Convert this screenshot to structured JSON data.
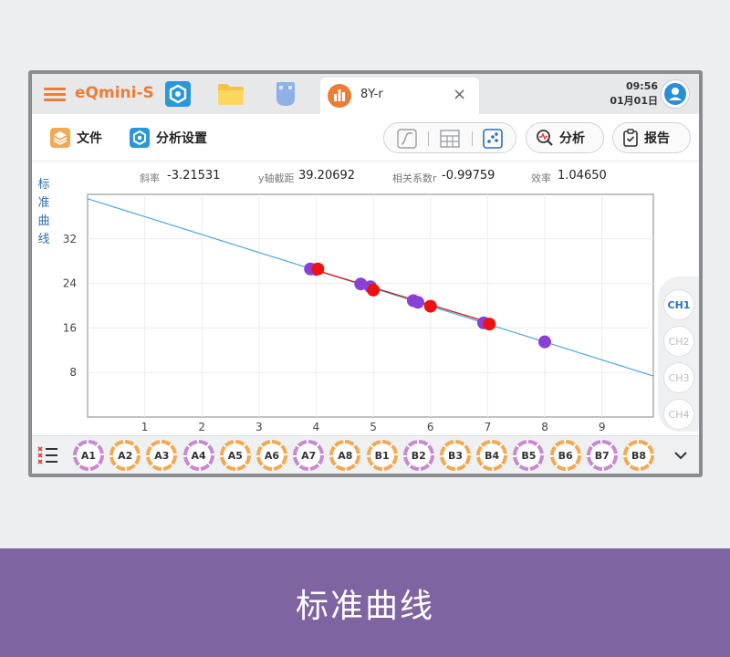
{
  "app": {
    "brand": "eQmini-S",
    "doc_tab_name": "8Y-r",
    "doc_tab_close": "×",
    "time": "09:56",
    "date": "01月01日"
  },
  "toolbar": {
    "file_label": "文件",
    "analysis_settings_label": "分析设置",
    "analyze_label": "分析",
    "report_label": "报告"
  },
  "stats": {
    "slope_label": "斜率",
    "slope_value": "-3.21531",
    "intercept_label": "y轴截距",
    "intercept_value": "39.20692",
    "correlation_label": "相关系数r",
    "correlation_value": "-0.99759",
    "efficiency_label": "效率",
    "efficiency_value": "1.04650"
  },
  "side_title": [
    "标",
    "准",
    "曲",
    "线"
  ],
  "channels": [
    {
      "label": "CH1",
      "active": true
    },
    {
      "label": "CH2",
      "active": false
    },
    {
      "label": "CH3",
      "active": false
    },
    {
      "label": "CH4",
      "active": false
    }
  ],
  "wells": [
    {
      "label": "A1",
      "color": "#c889d1"
    },
    {
      "label": "A2",
      "color": "#f3a953"
    },
    {
      "label": "A3",
      "color": "#f3a953"
    },
    {
      "label": "A4",
      "color": "#c889d1"
    },
    {
      "label": "A5",
      "color": "#f3a953"
    },
    {
      "label": "A6",
      "color": "#f3a953"
    },
    {
      "label": "A7",
      "color": "#c889d1"
    },
    {
      "label": "A8",
      "color": "#f3a953"
    },
    {
      "label": "B1",
      "color": "#f3a953"
    },
    {
      "label": "B2",
      "color": "#c889d1"
    },
    {
      "label": "B3",
      "color": "#f3a953"
    },
    {
      "label": "B4",
      "color": "#f3a953"
    },
    {
      "label": "B5",
      "color": "#c889d1"
    },
    {
      "label": "B6",
      "color": "#f3a953"
    },
    {
      "label": "B7",
      "color": "#c889d1"
    },
    {
      "label": "B8",
      "color": "#f3a953"
    }
  ],
  "colors": {
    "accent": "#ee7d33",
    "standard_line": "#4aa8d8",
    "fit_line": "#cc2222",
    "point_purple": "#8a3fd6",
    "point_red": "#ee1111",
    "banner": "#7e64a0"
  },
  "chart_data": {
    "type": "scatter",
    "xlim": [
      0,
      9.9
    ],
    "ylim": [
      0,
      40
    ],
    "x_ticks": [
      1,
      2,
      3,
      4,
      5,
      6,
      7,
      8,
      9
    ],
    "y_ticks": [
      8,
      16,
      24,
      32
    ],
    "grid": true,
    "standard_curve": {
      "slope": -3.21531,
      "intercept": 39.20692
    },
    "fit_segment": {
      "x": [
        3.95,
        7.05
      ],
      "y": [
        26.5,
        16.9
      ]
    },
    "series": [
      {
        "color_key": "point_purple",
        "points": [
          [
            3.9,
            26.6
          ],
          [
            4.0,
            26.5
          ],
          [
            4.78,
            23.9
          ],
          [
            4.95,
            23.4
          ],
          [
            5.7,
            20.9
          ],
          [
            5.78,
            20.6
          ],
          [
            6.93,
            16.9
          ],
          [
            8.0,
            13.5
          ]
        ]
      },
      {
        "color_key": "point_red",
        "points": [
          [
            4.03,
            26.6
          ],
          [
            5.0,
            22.8
          ],
          [
            6.0,
            19.9
          ],
          [
            7.03,
            16.7
          ]
        ]
      }
    ]
  },
  "banner": {
    "title": "标准曲线"
  }
}
